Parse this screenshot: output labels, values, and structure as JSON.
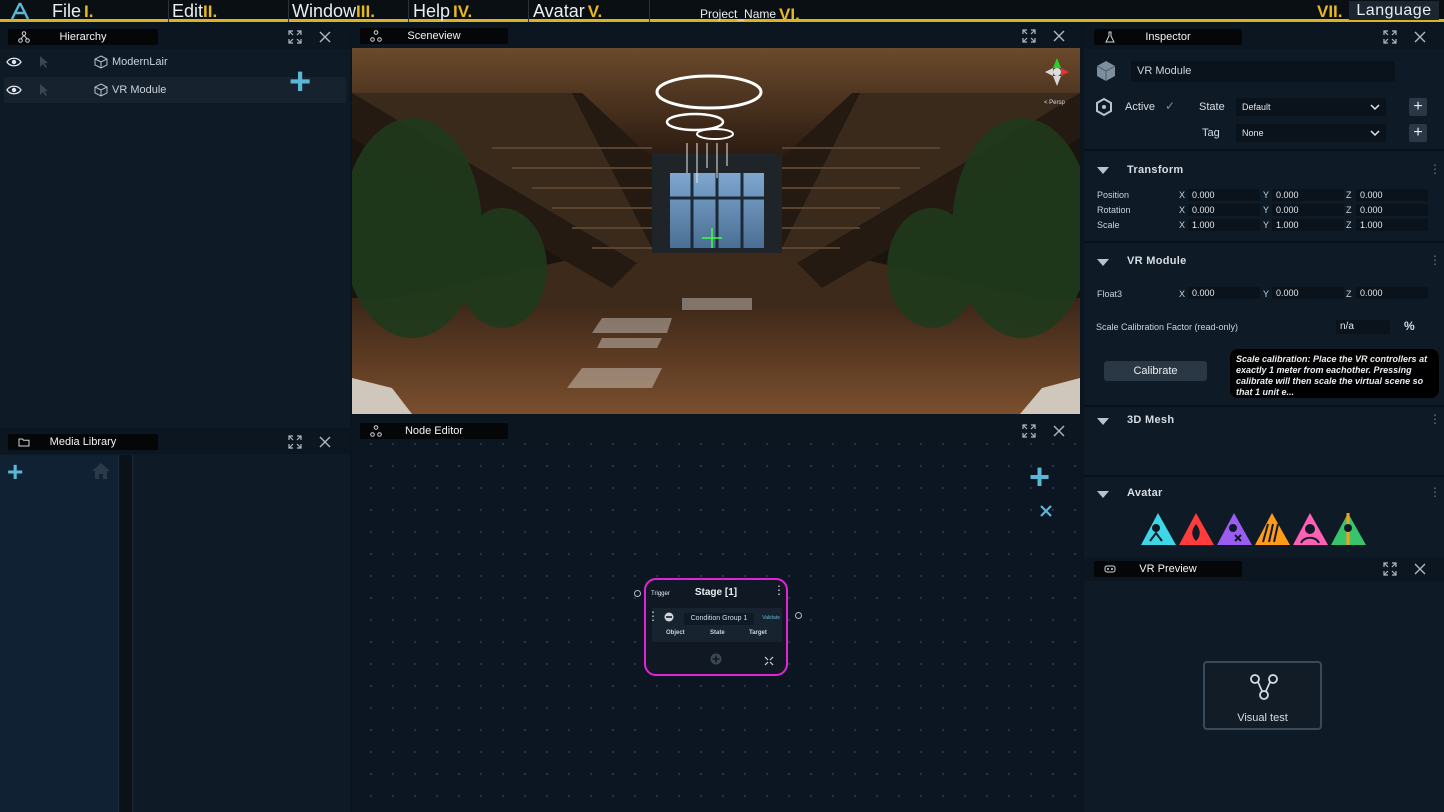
{
  "menubar": {
    "items": [
      {
        "label": "File",
        "num": "I."
      },
      {
        "label": "Edit",
        "num": "II."
      },
      {
        "label": "Window",
        "num": "III."
      },
      {
        "label": "Help",
        "num": "IV."
      },
      {
        "label": "Avatar",
        "num": "V."
      }
    ],
    "project_name": "Project_Name",
    "project_num": "VI.",
    "language_num": "VII.",
    "language_label": "Language"
  },
  "hierarchy": {
    "title": "Hierarchy",
    "items": [
      {
        "label": "ModernLair"
      },
      {
        "label": "VR Module"
      }
    ]
  },
  "media_library": {
    "title": "Media Library"
  },
  "sceneview": {
    "title": "Sceneview",
    "persp_label": "< Persp"
  },
  "node_editor": {
    "title": "Node Editor",
    "node": {
      "title": "Stage [1]",
      "trigger": "Trigger",
      "condition_group": "Condition Group 1",
      "validate": "Validate",
      "col_object": "Object",
      "col_state": "State",
      "col_target": "Target"
    }
  },
  "inspector": {
    "title": "Inspector",
    "object_name": "VR Module",
    "active_label": "Active",
    "state_label": "State",
    "state_value": "Default",
    "tag_label": "Tag",
    "tag_value": "None",
    "transform": {
      "title": "Transform",
      "rows": [
        {
          "label": "Position",
          "x": "0.000",
          "y": "0.000",
          "z": "0.000"
        },
        {
          "label": "Rotation",
          "x": "0.000",
          "y": "0.000",
          "z": "0.000"
        },
        {
          "label": "Scale",
          "x": "1.000",
          "y": "1.000",
          "z": "1.000"
        }
      ]
    },
    "vr_module": {
      "title": "VR Module",
      "float3_label": "Float3",
      "float3": {
        "x": "0.000",
        "y": "0.000",
        "z": "0.000"
      },
      "scale_label": "Scale Calibration Factor (read-only)",
      "scale_value": "n/a",
      "scale_unit": "%",
      "calibrate_label": "Calibrate",
      "tooltip": "Scale calibration: Place the VR controllers at exactly 1 meter from eachother. Pressing calibrate will then scale the virtual scene so that 1 unit e..."
    },
    "mesh": {
      "title": "3D Mesh"
    },
    "avatar": {
      "title": "Avatar",
      "colors": [
        "#3fd6e6",
        "#ff3b3b",
        "#9b5cf0",
        "#ff9a1a",
        "#ff5fb4",
        "#37c46a"
      ]
    }
  },
  "vr_preview": {
    "title": "VR Preview",
    "visual_test_label": "Visual test"
  },
  "axis_labels": {
    "x": "X",
    "y": "Y",
    "z": "Z"
  },
  "colors": {
    "accent": "#5ab7d6",
    "menu_underline": "#d9b321",
    "node_border": "#e024d8"
  }
}
